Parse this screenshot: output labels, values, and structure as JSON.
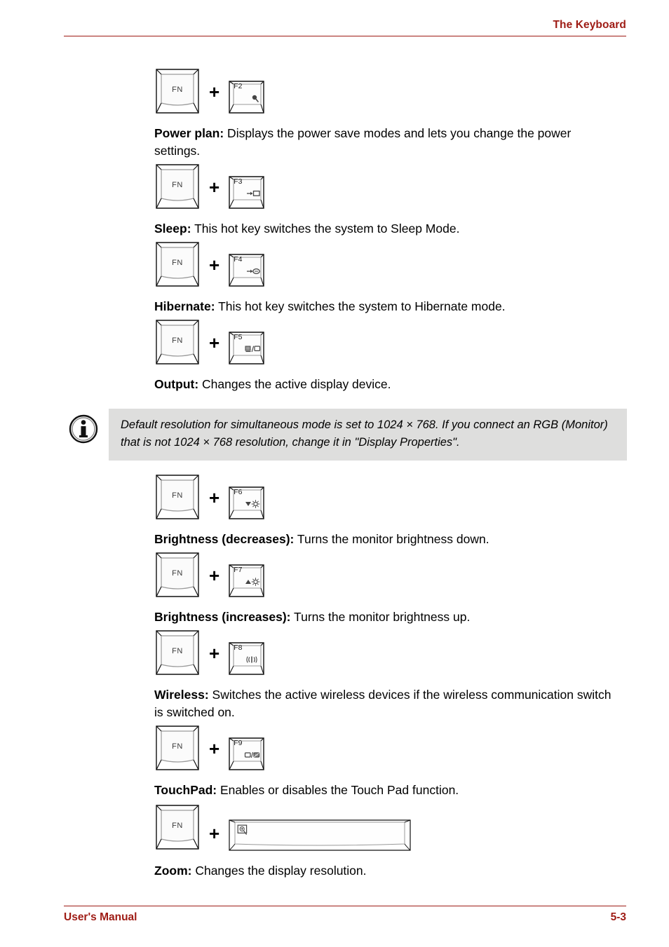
{
  "header": {
    "title": "The Keyboard"
  },
  "footer": {
    "left": "User's Manual",
    "right": "5-3"
  },
  "modifier_key": {
    "label": "FN",
    "icon": "fn-key-icon"
  },
  "plus": "+",
  "hotkeys": [
    {
      "key_label": "F2",
      "key_icon": "power-plan-icon",
      "term": "Power plan:",
      "description": " Displays the power save modes and lets you change the power settings."
    },
    {
      "key_label": "F3",
      "key_icon": "sleep-icon",
      "term": "Sleep:",
      "description": " This hot key switches the system to Sleep Mode."
    },
    {
      "key_label": "F4",
      "key_icon": "hibernate-icon",
      "term": "Hibernate:",
      "description": " This hot key switches the system to Hibernate mode."
    },
    {
      "key_label": "F5",
      "key_icon": "output-display-icon",
      "term": "Output:",
      "description": " Changes the active display device."
    },
    {
      "key_label": "F6",
      "key_icon": "brightness-down-icon",
      "term": "Brightness (decreases):",
      "description": " Turns the monitor brightness down."
    },
    {
      "key_label": "F7",
      "key_icon": "brightness-up-icon",
      "term": "Brightness (increases):",
      "description": " Turns the monitor brightness up."
    },
    {
      "key_label": "F8",
      "key_icon": "wireless-icon",
      "term": "Wireless:",
      "description": " Switches the active wireless devices if the wireless communication switch is switched on."
    },
    {
      "key_label": "F9",
      "key_icon": "touchpad-icon",
      "term": "TouchPad:",
      "description": " Enables or disables the Touch Pad function."
    },
    {
      "key_label": "",
      "key_icon": "zoom-magnifier-icon",
      "term": "Zoom:",
      "description": " Changes the display resolution."
    }
  ],
  "note": {
    "icon": "information-icon",
    "text": "Default resolution for simultaneous mode is set to 1024 × 768. If you connect an RGB (Monitor) that is not 1024 × 768 resolution, change it in \"Display Properties\"."
  },
  "colors": {
    "accent": "#9e1b14",
    "note_background": "#dededd",
    "text": "#000000"
  }
}
